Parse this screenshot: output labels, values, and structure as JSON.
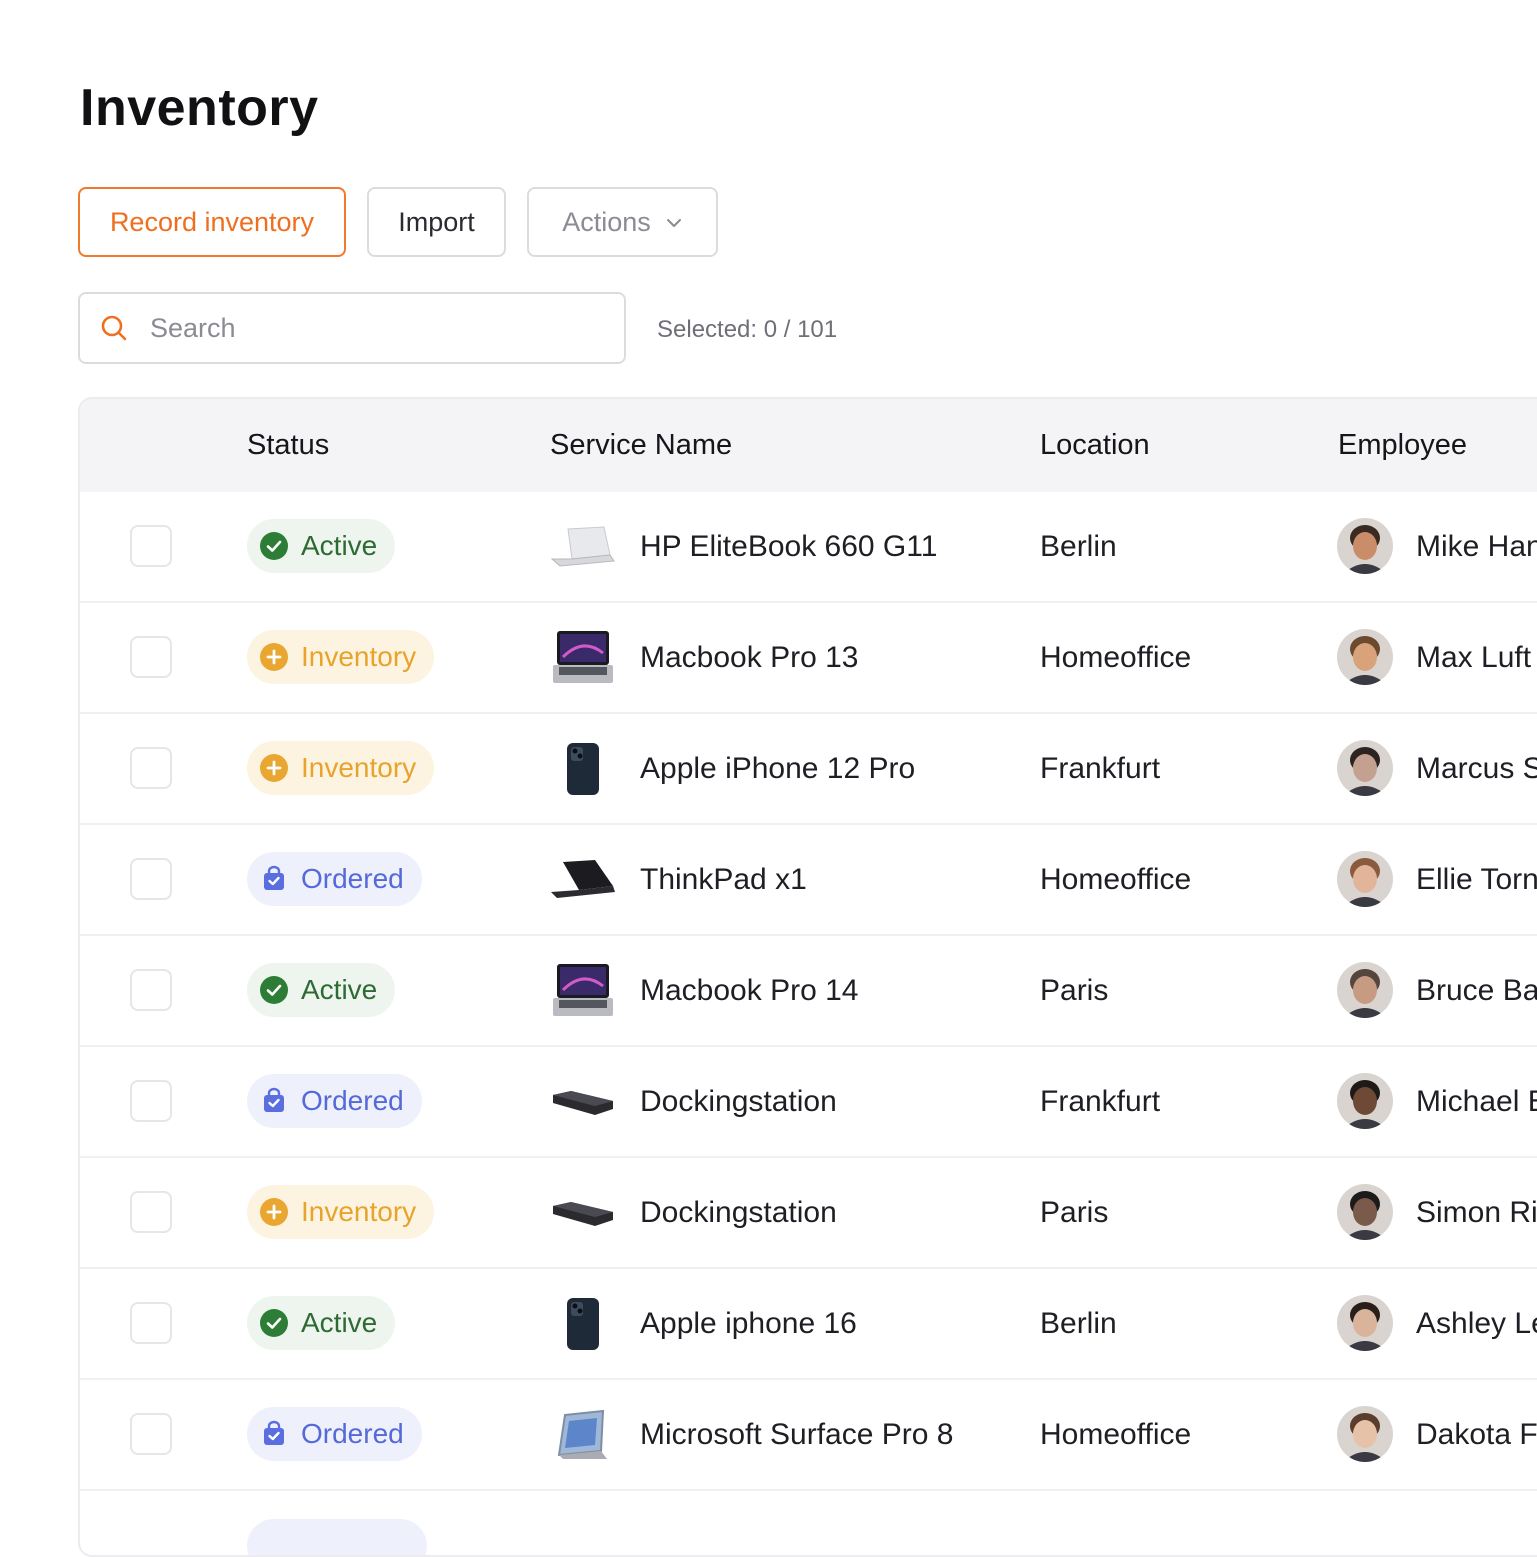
{
  "page": {
    "title": "Inventory"
  },
  "toolbar": {
    "record_label": "Record inventory",
    "import_label": "Import",
    "actions_label": "Actions"
  },
  "search": {
    "placeholder": "Search",
    "value": ""
  },
  "selection": {
    "text": "Selected: 0 / 101"
  },
  "table": {
    "headers": {
      "status": "Status",
      "service": "Service Name",
      "location": "Location",
      "employee": "Employee"
    },
    "rows": [
      {
        "status": "Active",
        "status_type": "active",
        "service": "HP EliteBook 660 G11",
        "device_icon": "laptop-silver-icon",
        "location": "Berlin",
        "employee": "Mike Han"
      },
      {
        "status": "Inventory",
        "status_type": "inventory",
        "service": "Macbook Pro 13",
        "device_icon": "macbook-icon",
        "location": "Homeoffice",
        "employee": "Max Luft"
      },
      {
        "status": "Inventory",
        "status_type": "inventory",
        "service": "Apple iPhone 12 Pro",
        "device_icon": "iphone-icon",
        "location": "Frankfurt",
        "employee": "Marcus S"
      },
      {
        "status": "Ordered",
        "status_type": "ordered",
        "service": "ThinkPad x1",
        "device_icon": "laptop-black-icon",
        "location": "Homeoffice",
        "employee": "Ellie Torn"
      },
      {
        "status": "Active",
        "status_type": "active",
        "service": "Macbook Pro 14",
        "device_icon": "macbook-icon",
        "location": "Paris",
        "employee": "Bruce Bar"
      },
      {
        "status": "Ordered",
        "status_type": "ordered",
        "service": "Dockingstation",
        "device_icon": "dock-icon",
        "location": "Frankfurt",
        "employee": "Michael E"
      },
      {
        "status": "Inventory",
        "status_type": "inventory",
        "service": "Dockingstation",
        "device_icon": "dock-icon",
        "location": "Paris",
        "employee": "Simon Ri"
      },
      {
        "status": "Active",
        "status_type": "active",
        "service": "Apple iphone 16",
        "device_icon": "iphone-icon",
        "location": "Berlin",
        "employee": "Ashley Le"
      },
      {
        "status": "Ordered",
        "status_type": "ordered",
        "service": "Microsoft Surface Pro 8",
        "device_icon": "surface-icon",
        "location": "Homeoffice",
        "employee": "Dakota Fa"
      }
    ]
  },
  "colors": {
    "accent": "#ee6f1e",
    "active": "#2e6a34",
    "inventory": "#e7a32a",
    "ordered": "#5569d8"
  }
}
